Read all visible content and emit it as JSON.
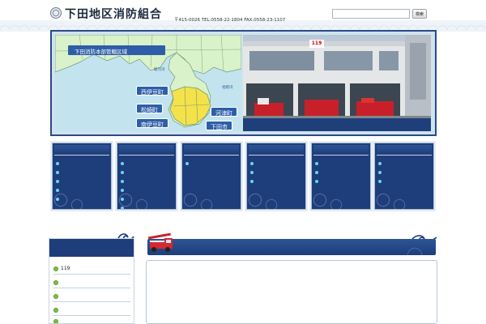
{
  "header": {
    "site_name": "下田地区消防組合",
    "site_name_roman": "",
    "links_text": "",
    "address": "〒415-0026",
    "contact": "TEL:0558-22-1804  FAX:0558-23-1107",
    "search_label": "",
    "search_placeholder": "",
    "search_value": "",
    "search_button": "検索"
  },
  "hero": {
    "map_title": "下田消防本部管轄区域",
    "sea_west": "駿河湾",
    "sea_east": "相模湾",
    "towns": [
      "西伊豆町",
      "松崎町",
      "南伊豆町",
      "河津町",
      "下田市"
    ],
    "station_sign": "119",
    "photo_caption": ""
  },
  "nav": [
    {
      "title": "",
      "links": [
        "",
        "",
        "",
        "",
        ""
      ]
    },
    {
      "title": "",
      "links": [
        "",
        "",
        "",
        "",
        "",
        ""
      ]
    },
    {
      "title": "",
      "links": [
        ""
      ]
    },
    {
      "title": "",
      "links": [
        "",
        "",
        ""
      ]
    },
    {
      "title": "",
      "links": [
        "",
        "",
        ""
      ]
    },
    {
      "title": "",
      "links": [
        "",
        "",
        ""
      ]
    }
  ],
  "breadcrumb": "",
  "sidebar": {
    "title": "",
    "items": [
      "119",
      "",
      "",
      "",
      ""
    ]
  },
  "main": {
    "title": "",
    "news": [
      {
        "date": "",
        "headline": ""
      }
    ]
  },
  "colors": {
    "navy": "#1e3d7b",
    "accent_cyan": "#6ad4f2",
    "bullet_green": "#7bc043",
    "link_blue": "#2336b5",
    "map_yellow": "#f5e24a",
    "map_green": "#d9f2c9",
    "sea": "#c3e4ef"
  }
}
